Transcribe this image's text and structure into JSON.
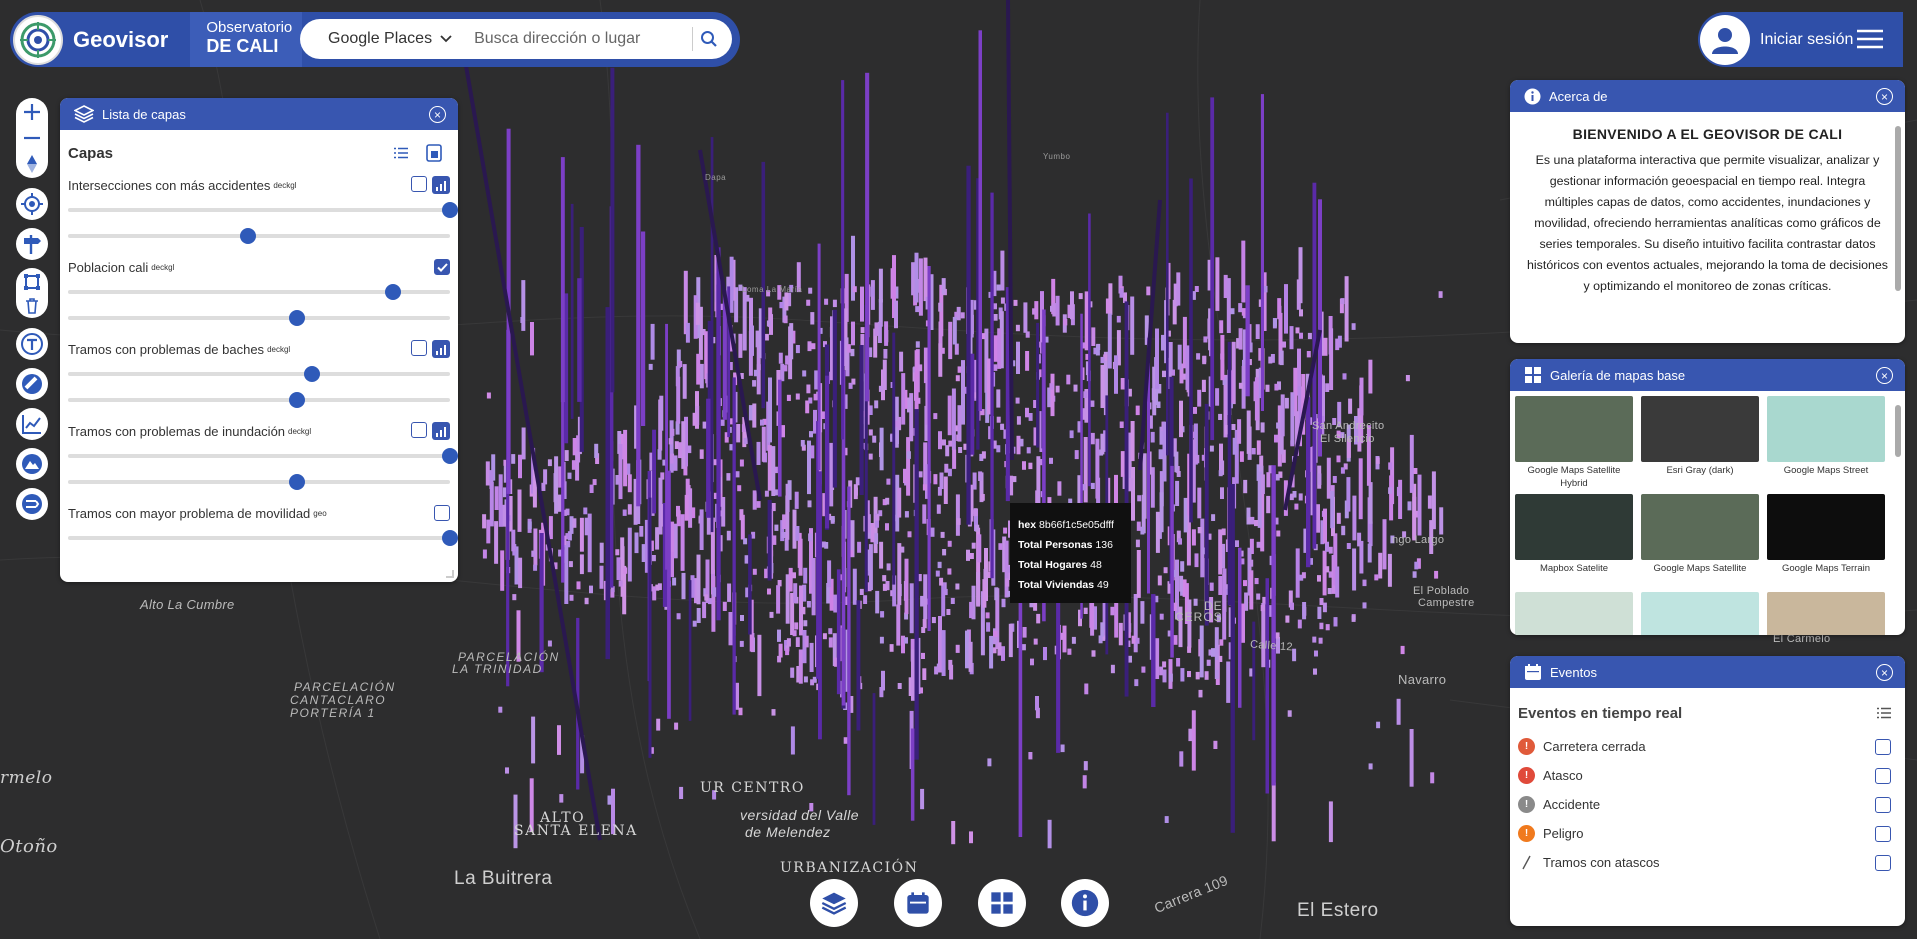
{
  "app": {
    "brand": "Geovisor",
    "observatorio_line1": "Observatorio",
    "observatorio_line2": "DE CALI"
  },
  "search": {
    "provider": "Google Places",
    "placeholder": "Busca dirección o lugar"
  },
  "user": {
    "login_label": "Iniciar sesión"
  },
  "layers_panel": {
    "title": "Lista de capas",
    "section_title": "Capas",
    "layers": [
      {
        "name": "Intersecciones con más accidentes",
        "tag": "deckgl",
        "checked": false,
        "has_chart": true,
        "sliders": [
          100,
          47
        ]
      },
      {
        "name": "Poblacion cali",
        "tag": "deckgl",
        "checked": true,
        "has_chart": false,
        "sliders": [
          85,
          60
        ]
      },
      {
        "name": "Tramos con problemas de baches",
        "tag": "deckgl",
        "checked": false,
        "has_chart": true,
        "sliders": [
          64,
          60
        ]
      },
      {
        "name": "Tramos con problemas de inundación",
        "tag": "deckgl",
        "checked": false,
        "has_chart": true,
        "sliders": [
          100,
          60
        ]
      },
      {
        "name": "Tramos con mayor problema de movilidad",
        "tag": "geo",
        "checked": false,
        "has_chart": false,
        "sliders": [
          100
        ]
      }
    ]
  },
  "about_panel": {
    "title": "Acerca de",
    "heading": "BIENVENIDO A EL GEOVISOR DE CALI",
    "body": "Es una plataforma interactiva que permite visualizar, analizar y gestionar información geoespacial en tiempo real. Integra múltiples capas de datos, como accidentes, inundaciones y movilidad, ofreciendo herramientas analíticas como gráficos de series temporales. Su diseño intuitivo facilita contrastar datos históricos con eventos actuales, mejorando la toma de decisiones y optimizando el monitoreo de zonas críticas."
  },
  "gallery_panel": {
    "title": "Galería de mapas base",
    "maps": [
      {
        "label": "Google Maps Satellite Hybrid",
        "color": "#5b6b58"
      },
      {
        "label": "Esri Gray (dark)",
        "color": "#3a3a3a"
      },
      {
        "label": "Google Maps Street",
        "color": "#a9d8cf"
      },
      {
        "label": "Mapbox Satelite",
        "color": "#2f3a36"
      },
      {
        "label": "Google Maps Satellite",
        "color": "#5b6b58"
      },
      {
        "label": "Google Maps Terrain",
        "color": "#0d0d0d"
      },
      {
        "label": "",
        "color": "#cfe0d6"
      },
      {
        "label": "",
        "color": "#bfe4e0"
      },
      {
        "label": "",
        "color": "#c9b79c"
      }
    ]
  },
  "events_panel": {
    "title": "Eventos",
    "section_title": "Eventos en tiempo real",
    "items": [
      {
        "label": "Carretera cerrada",
        "icon": "road-closed-icon",
        "color": "#e05a3a"
      },
      {
        "label": "Atasco",
        "icon": "traffic-jam-icon",
        "color": "#e04a3a"
      },
      {
        "label": "Accidente",
        "icon": "accident-icon",
        "color": "#8a8a8a"
      },
      {
        "label": "Peligro",
        "icon": "hazard-icon",
        "color": "#f07a1e"
      },
      {
        "label": "Tramos con atascos",
        "icon": "segment-line-icon",
        "color": "#555555"
      }
    ]
  },
  "tooltip": {
    "hex_label": "hex",
    "hex_value": "8b66f1c5e05dfff",
    "personas_label": "Total Personas",
    "personas_value": "136",
    "hogares_label": "Total Hogares",
    "hogares_value": "48",
    "viviendas_label": "Total Viviendas",
    "viviendas_value": "49"
  },
  "map_labels": {
    "alto_cumbre": "Alto La Cumbre",
    "parcelacion": "PARCELACIÓN",
    "cantaclaro": "CANTACLARO",
    "porteria": "PORTERÍA 1",
    "parcelacion2": "PARCELACIÓN",
    "trinidad": "LA TRINIDAD",
    "armelo": "rmelo",
    "otono": "Otoño",
    "la_buitrera": "La Buitrera",
    "alto_santa_elena": "ALTO",
    "santa_elena": "SANTA ELENA",
    "centro": "UR CENTRO",
    "universidad": "versidad del Valle",
    "melendez": "de Melendez",
    "urbanizacion": "URBANIZACIÓN",
    "el_estero": "El Estero",
    "carrera_109": "Carrera 109",
    "navarro": "Navarro",
    "el_carmelo": "El Carmelo",
    "calle_12": "Calle 12",
    "el_poblado": "El Poblado",
    "campestre": "Campestre",
    "san_andrecito": "San Andrecito",
    "el_silencio": "El Silencio",
    "chorro_largo": "ngo Largo",
    "de_cerros": "DE",
    "cerros": "CEROS",
    "la_maria": "Loma La María",
    "yumbo": "Yumbo",
    "dapa": "Dapa"
  }
}
